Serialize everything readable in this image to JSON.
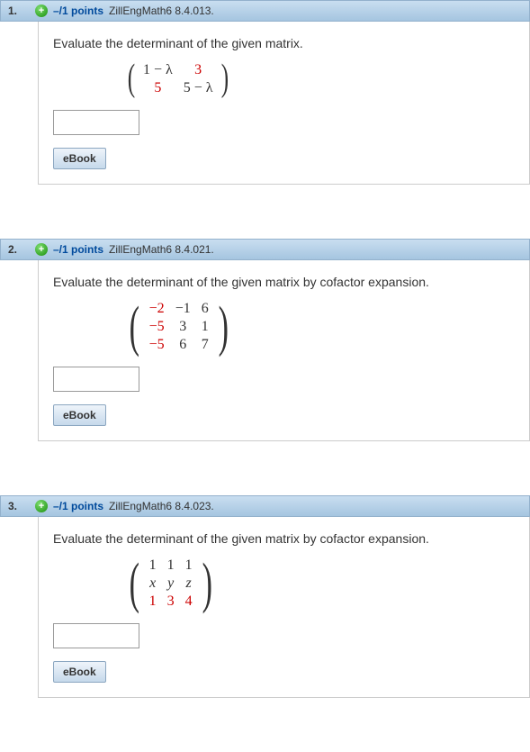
{
  "questions": [
    {
      "number": "1.",
      "points": "–/1 points",
      "source": "ZillEngMath6 8.4.013.",
      "prompt": "Evaluate the determinant of the given matrix.",
      "matrix": {
        "rows": 2,
        "cells": [
          [
            {
              "t": "1 − λ",
              "red": false
            },
            {
              "t": "3",
              "red": true
            }
          ],
          [
            {
              "t": "5",
              "red": true
            },
            {
              "t": "5 − λ",
              "red": false
            }
          ]
        ]
      },
      "ebook_label": "eBook"
    },
    {
      "number": "2.",
      "points": "–/1 points",
      "source": "ZillEngMath6 8.4.021.",
      "prompt": "Evaluate the determinant of the given matrix by cofactor expansion.",
      "matrix": {
        "rows": 3,
        "cells": [
          [
            {
              "t": "−2",
              "red": true
            },
            {
              "t": "−1",
              "red": false
            },
            {
              "t": "6",
              "red": false
            }
          ],
          [
            {
              "t": "−5",
              "red": true
            },
            {
              "t": "3",
              "red": false
            },
            {
              "t": "1",
              "red": false
            }
          ],
          [
            {
              "t": "−5",
              "red": true
            },
            {
              "t": "6",
              "red": false
            },
            {
              "t": "7",
              "red": false
            }
          ]
        ]
      },
      "ebook_label": "eBook"
    },
    {
      "number": "3.",
      "points": "–/1 points",
      "source": "ZillEngMath6 8.4.023.",
      "prompt": "Evaluate the determinant of the given matrix by cofactor expansion.",
      "matrix": {
        "rows": 3,
        "cells": [
          [
            {
              "t": "1",
              "red": false
            },
            {
              "t": "1",
              "red": false
            },
            {
              "t": "1",
              "red": false
            }
          ],
          [
            {
              "t": "x",
              "red": false,
              "it": true
            },
            {
              "t": "y",
              "red": false,
              "it": true
            },
            {
              "t": "z",
              "red": false,
              "it": true
            }
          ],
          [
            {
              "t": "1",
              "red": true
            },
            {
              "t": "3",
              "red": true
            },
            {
              "t": "4",
              "red": true
            }
          ]
        ]
      },
      "ebook_label": "eBook"
    }
  ]
}
